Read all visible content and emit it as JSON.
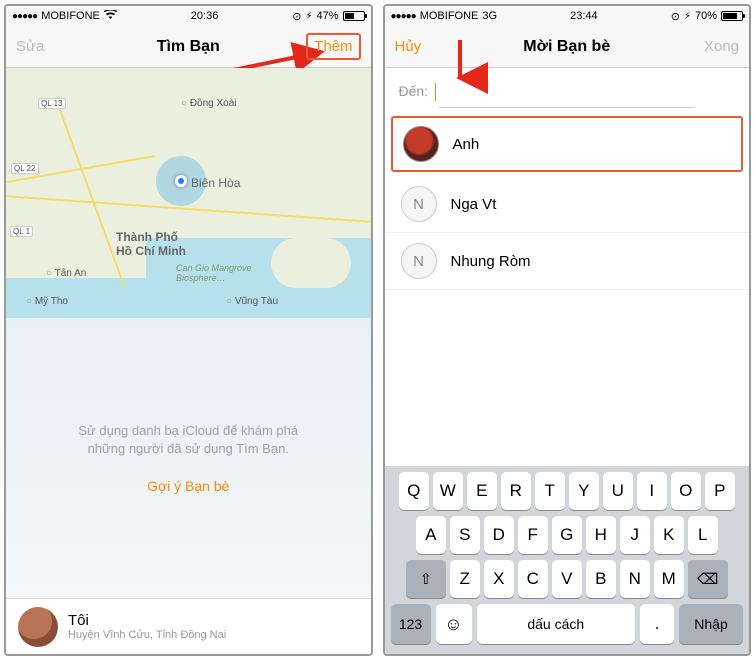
{
  "left": {
    "status": {
      "carrier": "MOBIFONE",
      "net_icon": "wifi",
      "time": "20:36",
      "batt_pct": "47%",
      "batt_fill": 47
    },
    "nav": {
      "left": "Sửa",
      "title": "Tìm Bạn",
      "right": "Thêm"
    },
    "map": {
      "main_city": "Biên Hòa",
      "cities": {
        "dong_xoai": "Đồng Xoài",
        "hcm_ln1": "Thành Phố",
        "hcm_ln2": "Hồ Chí Minh",
        "tan_an": "Tân An",
        "my_tho": "Mỹ Tho",
        "vung_tau": "Vũng Tàu",
        "can_gio": "Can Gio Mangrove",
        "can_gio2": "Biosphere…"
      },
      "roads": {
        "ql13": "QL 13",
        "ql22": "QL 22",
        "ql1": "QL 1"
      }
    },
    "suggest": {
      "line1": "Sử dụng danh bạ iCloud để khám phá",
      "line2": "những người đã sử dụng Tìm Bạn.",
      "link": "Gợi ý Bạn bè"
    },
    "me": {
      "name": "Tôi",
      "sub": "Huyện Vĩnh Cửu, Tỉnh Đồng Nai"
    }
  },
  "right": {
    "status": {
      "carrier": "MOBIFONE",
      "net": "3G",
      "time": "23:44",
      "batt_pct": "70%",
      "batt_fill": 70
    },
    "nav": {
      "left": "Hủy",
      "title": "Mời Bạn bè",
      "right": "Xong"
    },
    "to_label": "Đến:",
    "contacts": [
      {
        "name": "Anh",
        "initial": "",
        "photo": true
      },
      {
        "name": "Nga Vt",
        "initial": "N",
        "photo": false
      },
      {
        "name": "Nhung Ròm",
        "initial": "N",
        "photo": false
      }
    ],
    "keyboard": {
      "row1": [
        "Q",
        "W",
        "E",
        "R",
        "T",
        "Y",
        "U",
        "I",
        "O",
        "P"
      ],
      "row2": [
        "A",
        "S",
        "D",
        "F",
        "G",
        "H",
        "J",
        "K",
        "L"
      ],
      "row3": [
        "Z",
        "X",
        "C",
        "V",
        "B",
        "N",
        "M"
      ],
      "num": "123",
      "space": "dấu cách",
      "dot": ".",
      "enter": "Nhập"
    }
  }
}
